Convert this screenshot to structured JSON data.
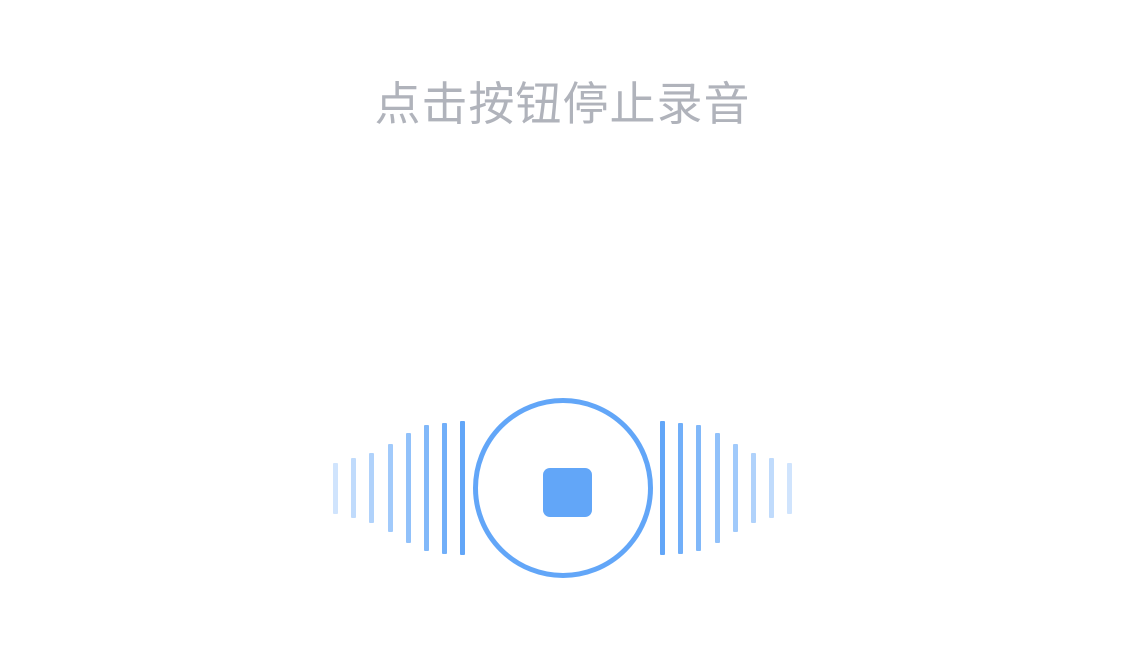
{
  "hint": {
    "text": "点击按钮停止录音"
  },
  "colors": {
    "hint_text": "#b0b3bb",
    "accent": "#62a6f8",
    "background": "#ffffff"
  },
  "recorder": {
    "state": "recording",
    "stop_icon": "stop-square-icon",
    "left_levels": [
      0.38,
      0.45,
      0.52,
      0.66,
      0.82,
      0.94,
      0.98,
      1.0
    ],
    "right_levels": [
      1.0,
      0.98,
      0.94,
      0.82,
      0.66,
      0.52,
      0.45,
      0.38
    ]
  }
}
